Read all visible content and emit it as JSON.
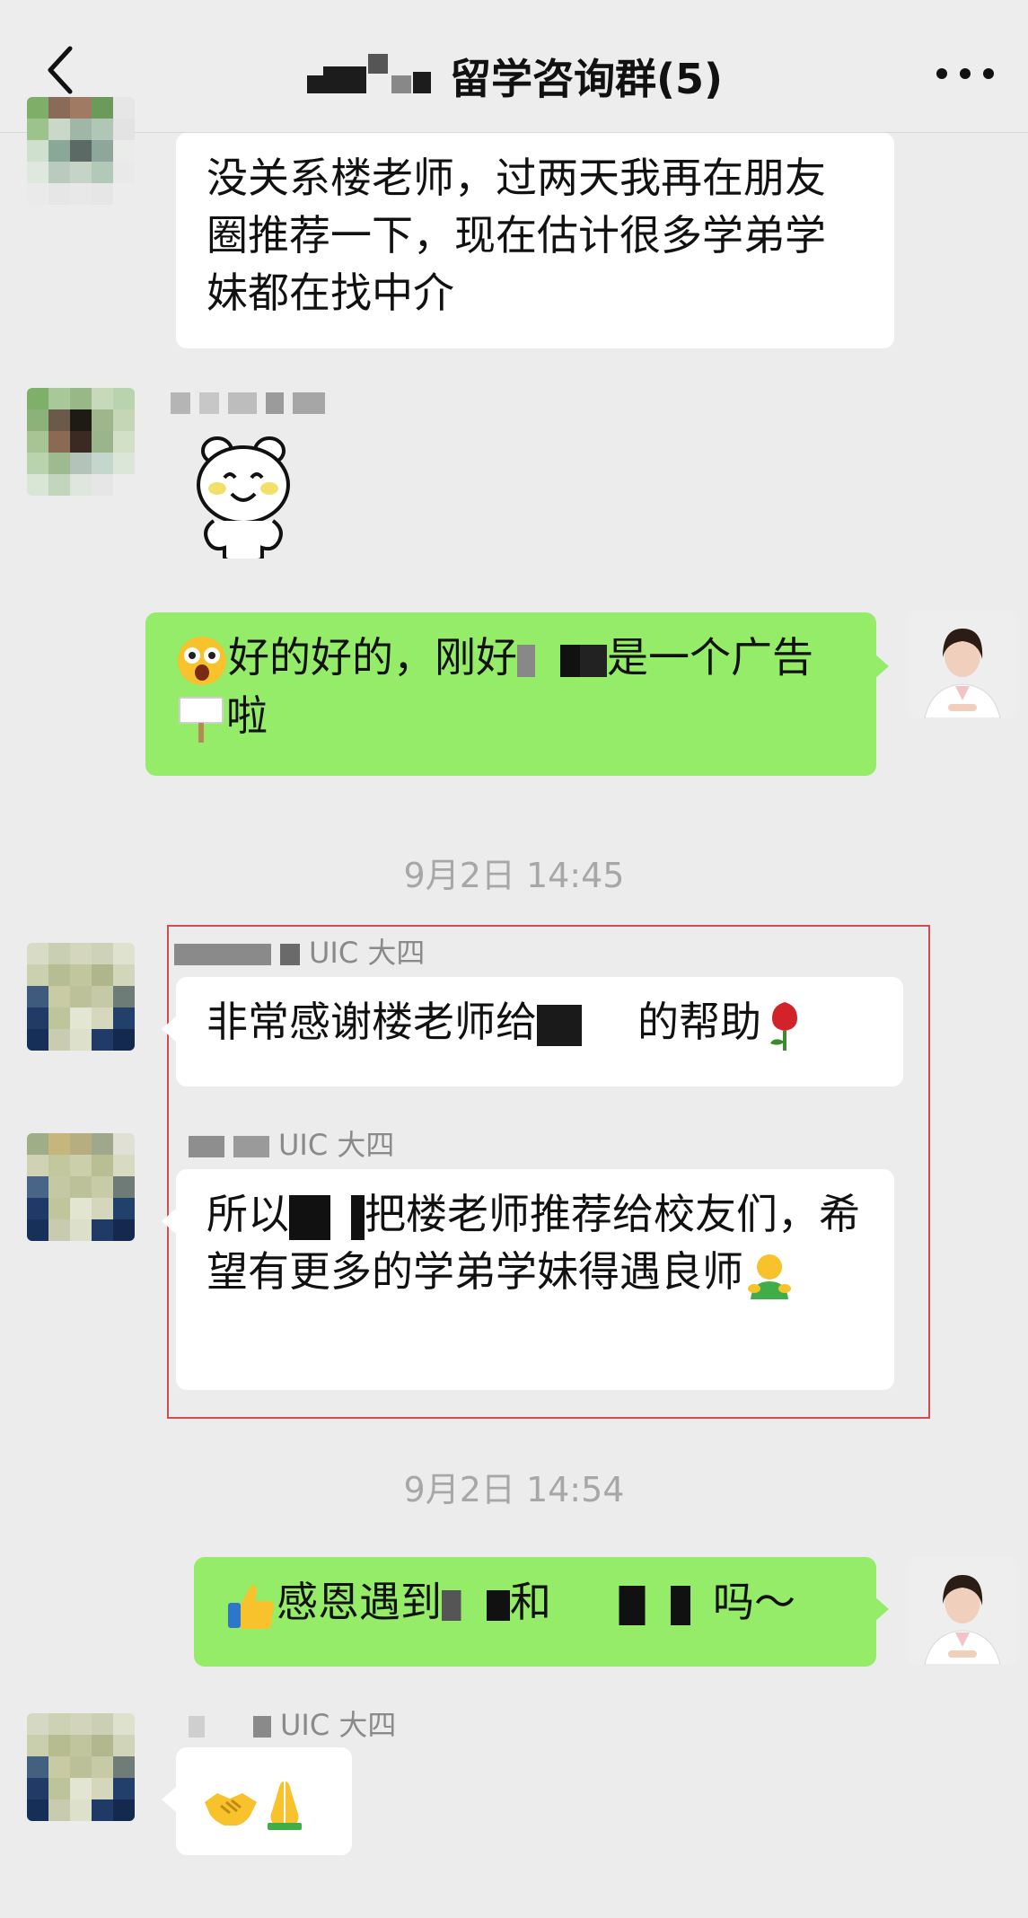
{
  "header": {
    "title": "留学咨询群(5)",
    "back_icon": "chevron-left-icon",
    "more_icon": "more-dots-icon"
  },
  "messages": [
    {
      "id": "m1",
      "side": "left",
      "text": "没关系楼老师，过两天我再在朋友圈推荐一下，现在估计很多学弟学妹都在找中介"
    },
    {
      "id": "m2",
      "side": "left",
      "type": "sticker",
      "sticker": "bear-sticker"
    },
    {
      "id": "m3",
      "side": "right",
      "parts": [
        "好的好的，刚好",
        "是一个广告",
        "啦"
      ]
    },
    {
      "id": "m4",
      "side": "left",
      "sender_suffix": "UIC 大四",
      "parts": [
        "非常感谢楼老师给",
        "的帮助"
      ]
    },
    {
      "id": "m5",
      "side": "left",
      "sender_suffix": "UIC 大四",
      "parts": [
        "所以",
        "把楼老师推荐给校友们，希望有更多的学弟学妹得遇良师"
      ]
    },
    {
      "id": "m6",
      "side": "right",
      "parts": [
        "感恩遇到",
        "和",
        "吗～"
      ]
    },
    {
      "id": "m7",
      "side": "left",
      "sender_suffix": "UIC 大四",
      "type": "emoji"
    }
  ],
  "timestamps": [
    "9月2日 14:45",
    "9月2日 14:54"
  ],
  "colors": {
    "background": "#ececec",
    "bubble_green": "#95ec69",
    "bubble_white": "#ffffff",
    "highlight_border": "#d94a4a"
  }
}
